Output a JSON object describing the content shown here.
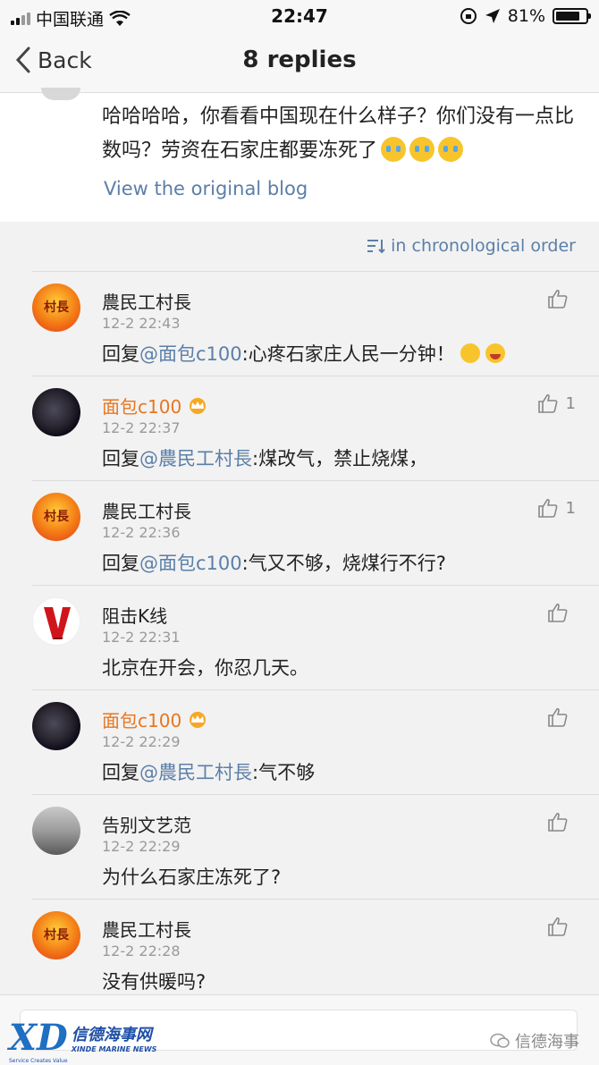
{
  "status": {
    "carrier": "中国联通",
    "time": "22:47",
    "battery_text": "81%",
    "battery_level": 0.81
  },
  "nav": {
    "back_label": "Back",
    "title": "8 replies"
  },
  "original": {
    "text": "哈哈哈哈，你看看中国现在什么样子？你们没有一点比数吗？劳资在石家庄都要冻死了",
    "view_link": "View the original blog"
  },
  "sort": {
    "label": "in chronological order"
  },
  "comments": [
    {
      "name": "農民工村長",
      "avatar_text": "村長",
      "time": "12-2 22:43",
      "prefix": "回复",
      "mention": "@面包c100",
      "text": ":心疼石家庄人民一分钟！",
      "likes": ""
    },
    {
      "name": "面包c100",
      "time": "12-2 22:37",
      "prefix": "回复",
      "mention": "@農民工村長",
      "text": ":煤改气，禁止烧煤，",
      "likes": "1"
    },
    {
      "name": "農民工村長",
      "avatar_text": "村長",
      "time": "12-2 22:36",
      "prefix": "回复",
      "mention": "@面包c100",
      "text": ":气又不够，烧煤行不行?",
      "likes": "1"
    },
    {
      "name": "阻击K线",
      "time": "12-2 22:31",
      "prefix": "",
      "mention": "",
      "text": "北京在开会，你忍几天。",
      "likes": ""
    },
    {
      "name": "面包c100",
      "time": "12-2 22:29",
      "prefix": "回复",
      "mention": "@農民工村長",
      "text": ":气不够",
      "likes": ""
    },
    {
      "name": "告别文艺范",
      "time": "12-2 22:29",
      "prefix": "",
      "mention": "",
      "text": "为什么石家庄冻死了?",
      "likes": ""
    },
    {
      "name": "農民工村長",
      "avatar_text": "村長",
      "time": "12-2 22:28",
      "prefix": "",
      "mention": "",
      "text": "没有供暖吗?",
      "likes": ""
    }
  ],
  "watermark": {
    "logo": "XD",
    "cn": "信德海事网",
    "en": "XINDE MARINE NEWS",
    "tagline": "Service Creates Value",
    "right": "信德海事"
  },
  "colors": {
    "link": "#5b7fa8",
    "vip_name": "#e8761f"
  }
}
